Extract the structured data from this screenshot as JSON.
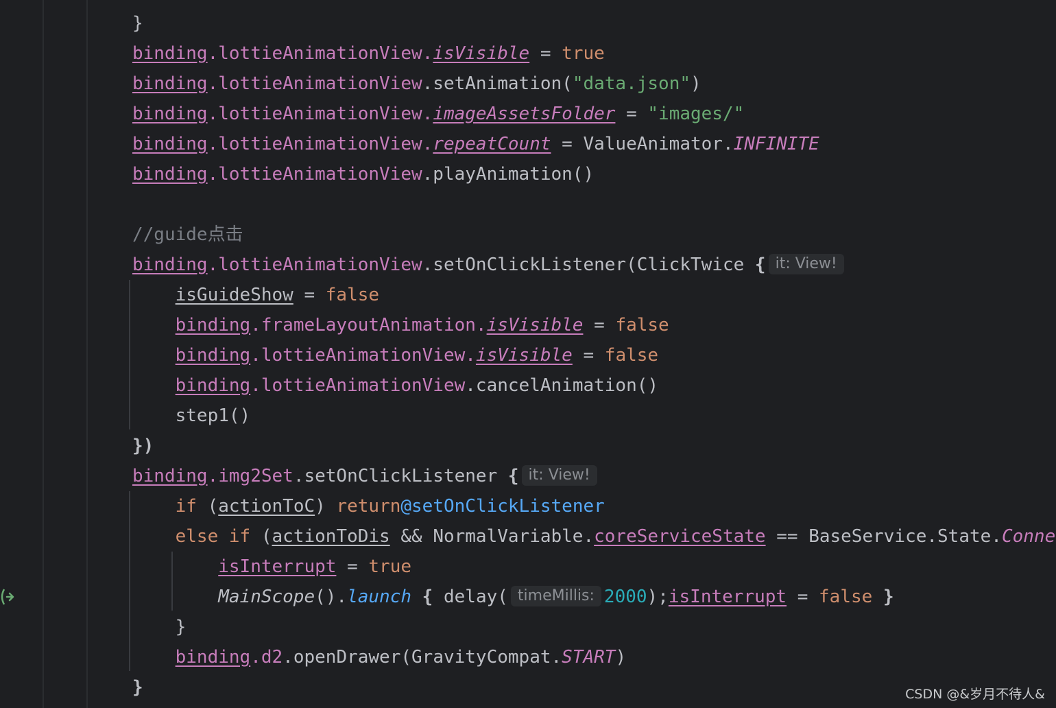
{
  "watermark": "CSDN @&岁月不待人&",
  "code_lines": [
    [
      {
        "t": "}",
        "c": "plain"
      }
    ],
    [
      {
        "t": "binding",
        "c": "prop-u"
      },
      {
        "t": ".lottieAnimationView.",
        "c": "prop"
      },
      {
        "t": "isVisible",
        "c": "prop-iu"
      },
      {
        "t": " = ",
        "c": "plain"
      },
      {
        "t": "true",
        "c": "kw"
      }
    ],
    [
      {
        "t": "binding",
        "c": "prop-u"
      },
      {
        "t": ".lottieAnimationView",
        "c": "prop"
      },
      {
        "t": ".setAnimation(",
        "c": "plain"
      },
      {
        "t": "\"data.json\"",
        "c": "str"
      },
      {
        "t": ")",
        "c": "plain"
      }
    ],
    [
      {
        "t": "binding",
        "c": "prop-u"
      },
      {
        "t": ".lottieAnimationView.",
        "c": "prop"
      },
      {
        "t": "imageAssetsFolder",
        "c": "prop-iu"
      },
      {
        "t": " = ",
        "c": "plain"
      },
      {
        "t": "\"images/\"",
        "c": "str"
      }
    ],
    [
      {
        "t": "binding",
        "c": "prop-u"
      },
      {
        "t": ".lottieAnimationView.",
        "c": "prop"
      },
      {
        "t": "repeatCount",
        "c": "prop-iu"
      },
      {
        "t": " = ValueAnimator.",
        "c": "plain"
      },
      {
        "t": "INFINITE",
        "c": "const-i"
      }
    ],
    [
      {
        "t": "binding",
        "c": "prop-u"
      },
      {
        "t": ".lottieAnimationView",
        "c": "prop"
      },
      {
        "t": ".playAnimation()",
        "c": "plain"
      }
    ],
    [],
    [
      {
        "t": "//guide点击",
        "c": "comment"
      }
    ],
    [
      {
        "t": "binding",
        "c": "prop-u"
      },
      {
        "t": ".lottieAnimationView",
        "c": "prop"
      },
      {
        "t": ".setOnClickListener(ClickTwice ",
        "c": "plain"
      },
      {
        "t": "{",
        "c": "brace"
      },
      {
        "hint": "it: View!"
      }
    ],
    [
      {
        "t": "    ",
        "c": "plain"
      },
      {
        "t": "isGuideShow",
        "c": "var-u"
      },
      {
        "t": " = ",
        "c": "plain"
      },
      {
        "t": "false",
        "c": "kw"
      }
    ],
    [
      {
        "t": "    ",
        "c": "plain"
      },
      {
        "t": "binding",
        "c": "prop-u"
      },
      {
        "t": ".frameLayoutAnimation.",
        "c": "prop"
      },
      {
        "t": "isVisible",
        "c": "prop-iu"
      },
      {
        "t": " = ",
        "c": "plain"
      },
      {
        "t": "false",
        "c": "kw"
      }
    ],
    [
      {
        "t": "    ",
        "c": "plain"
      },
      {
        "t": "binding",
        "c": "prop-u"
      },
      {
        "t": ".lottieAnimationView.",
        "c": "prop"
      },
      {
        "t": "isVisible",
        "c": "prop-iu"
      },
      {
        "t": " = ",
        "c": "plain"
      },
      {
        "t": "false",
        "c": "kw"
      }
    ],
    [
      {
        "t": "    ",
        "c": "plain"
      },
      {
        "t": "binding",
        "c": "prop-u"
      },
      {
        "t": ".lottieAnimationView",
        "c": "prop"
      },
      {
        "t": ".cancelAnimation()",
        "c": "plain"
      }
    ],
    [
      {
        "t": "    step1()",
        "c": "plain"
      }
    ],
    [
      {
        "t": "})",
        "c": "brace"
      }
    ],
    [
      {
        "t": "binding",
        "c": "prop-u"
      },
      {
        "t": ".img2Set",
        "c": "prop"
      },
      {
        "t": ".setOnClickListener ",
        "c": "plain"
      },
      {
        "t": "{",
        "c": "brace"
      },
      {
        "hint": "it: View!"
      }
    ],
    [
      {
        "t": "    ",
        "c": "plain"
      },
      {
        "t": "if",
        "c": "kw"
      },
      {
        "t": " (",
        "c": "plain"
      },
      {
        "t": "actionToC",
        "c": "var-u"
      },
      {
        "t": ") ",
        "c": "plain"
      },
      {
        "t": "return",
        "c": "kw"
      },
      {
        "t": "@setOnClickListener",
        "c": "label"
      }
    ],
    [
      {
        "t": "    ",
        "c": "plain"
      },
      {
        "t": "else if",
        "c": "kw"
      },
      {
        "t": " (",
        "c": "plain"
      },
      {
        "t": "actionToDis",
        "c": "var-u"
      },
      {
        "t": " && NormalVariable.",
        "c": "plain"
      },
      {
        "t": "coreServiceState",
        "c": "prop-u"
      },
      {
        "t": " == BaseService.State.",
        "c": "plain"
      },
      {
        "t": "Connected",
        "c": "const-i"
      }
    ],
    [
      {
        "t": "        ",
        "c": "plain"
      },
      {
        "t": "isInterrupt",
        "c": "prop-u"
      },
      {
        "t": " = ",
        "c": "plain"
      },
      {
        "t": "true",
        "c": "kw"
      }
    ],
    [
      {
        "t": "        ",
        "c": "plain"
      },
      {
        "t": "MainScope",
        "c": "italic"
      },
      {
        "t": "().",
        "c": "plain"
      },
      {
        "t": "launch",
        "c": "ext-i"
      },
      {
        "t": " ",
        "c": "plain"
      },
      {
        "t": "{",
        "c": "brace"
      },
      {
        "t": " delay(",
        "c": "plain"
      },
      {
        "hint": "timeMillis:"
      },
      {
        "t": "2000",
        "c": "num"
      },
      {
        "t": ");",
        "c": "plain"
      },
      {
        "t": "isInterrupt",
        "c": "prop-u"
      },
      {
        "t": " = ",
        "c": "plain"
      },
      {
        "t": "false",
        "c": "kw"
      },
      {
        "t": " ",
        "c": "plain"
      },
      {
        "t": "}",
        "c": "brace"
      }
    ],
    [
      {
        "t": "    }",
        "c": "plain"
      }
    ],
    [
      {
        "t": "    ",
        "c": "plain"
      },
      {
        "t": "binding",
        "c": "prop-u"
      },
      {
        "t": ".d2",
        "c": "prop"
      },
      {
        "t": ".openDrawer(GravityCompat.",
        "c": "plain"
      },
      {
        "t": "START",
        "c": "const-i"
      },
      {
        "t": ")",
        "c": "plain"
      }
    ],
    [
      {
        "t": "}",
        "c": "brace"
      }
    ]
  ]
}
